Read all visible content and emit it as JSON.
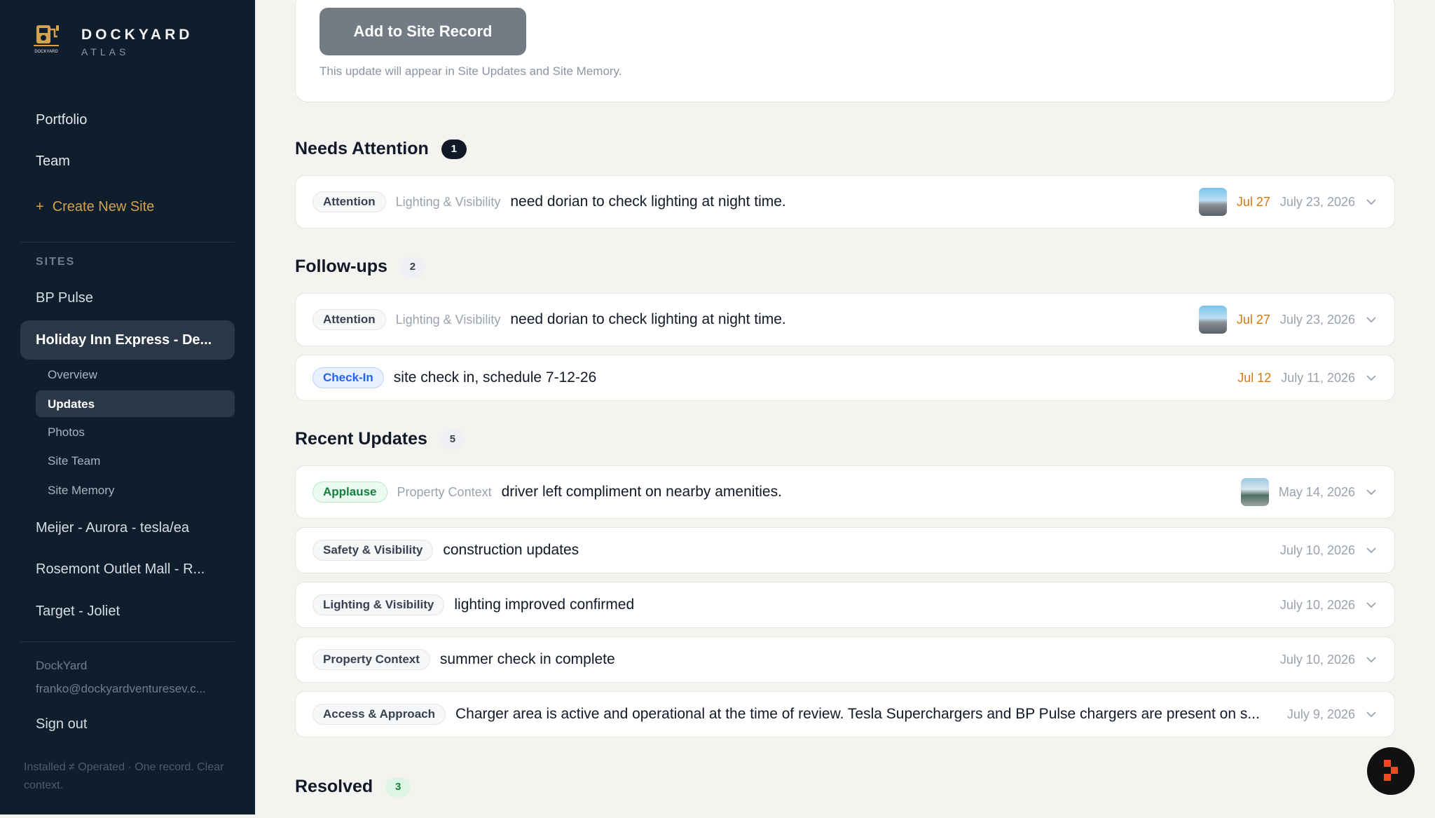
{
  "brand": {
    "name": "DOCKYARD",
    "sub": "ATLAS"
  },
  "nav": {
    "portfolio": "Portfolio",
    "team": "Team",
    "create_site": "Create New Site",
    "create_plus": "+"
  },
  "sites": {
    "heading": "SITES",
    "items": [
      "BP Pulse",
      "Holiday Inn Express - De...",
      "Meijer - Aurora - tesla/ea",
      "Rosemont Outlet Mall - R...",
      "Target - Joliet"
    ],
    "active_index": 1,
    "subnav": [
      "Overview",
      "Updates",
      "Photos",
      "Site Team",
      "Site Memory"
    ],
    "active_sub": "Updates"
  },
  "footer": {
    "org": "DockYard",
    "email": "franko@dockyardventuresev.c...",
    "signout": "Sign out",
    "tagline": "Installed ≠ Operated · One record. Clear context."
  },
  "composer": {
    "button": "Add to Site Record",
    "note": "This update will appear in Site Updates and Site Memory."
  },
  "sections": {
    "needs_attention": {
      "title": "Needs Attention",
      "count": "1",
      "rows": [
        {
          "tag": "Attention",
          "category": "Lighting & Visibility",
          "text": "need dorian to check lighting at night time.",
          "due": "Jul 27",
          "date": "July 23, 2026",
          "has_photo": true
        }
      ]
    },
    "follow_ups": {
      "title": "Follow-ups",
      "count": "2",
      "rows": [
        {
          "tag": "Attention",
          "category": "Lighting & Visibility",
          "text": "need dorian to check lighting at night time.",
          "due": "Jul 27",
          "date": "July 23, 2026",
          "has_photo": true
        },
        {
          "tag": "Check-In",
          "text": "site check in, schedule 7-12-26",
          "due": "Jul 12",
          "date": "July 11, 2026"
        }
      ]
    },
    "recent": {
      "title": "Recent Updates",
      "count": "5",
      "rows": [
        {
          "tag": "Applause",
          "category": "Property Context",
          "text": "driver left compliment on nearby amenities.",
          "date": "May 14, 2026",
          "has_photo": true
        },
        {
          "tag": "Safety & Visibility",
          "text": "construction updates",
          "date": "July 10, 2026"
        },
        {
          "tag": "Lighting & Visibility",
          "text": "lighting improved confirmed",
          "date": "July 10, 2026"
        },
        {
          "tag": "Property Context",
          "text": "summer check in complete",
          "date": "July 10, 2026"
        },
        {
          "tag": "Access & Approach",
          "text": "Charger area is active and operational at the time of review. Tesla Superchargers and BP Pulse chargers are present on s...",
          "date": "July 9, 2026"
        }
      ]
    },
    "resolved": {
      "title": "Resolved",
      "count": "3"
    }
  },
  "icons": {
    "logo": "charging-station-logo-icon",
    "chevron": "chevron-down-icon",
    "fab": "assistant-icon",
    "fab_color": "#f04a23"
  }
}
